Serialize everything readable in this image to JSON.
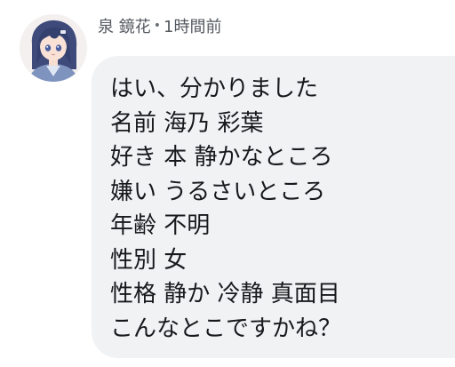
{
  "message": {
    "author_name": "泉 鏡花",
    "separator": "•",
    "timestamp": "1時間前",
    "lines": [
      "はい、分かりました",
      "名前 海乃 彩葉",
      "好き 本 静かなところ",
      "嫌い うるさいところ",
      "年齢 不明",
      "性別 女",
      "性格 静か 冷静 真面目",
      "こんなとこですかね？"
    ]
  },
  "colors": {
    "bubble_background": "#f1f2f4",
    "meta_text": "#555a60",
    "message_text": "#17191c"
  },
  "icons": {
    "avatar": "anime-girl-avatar"
  }
}
